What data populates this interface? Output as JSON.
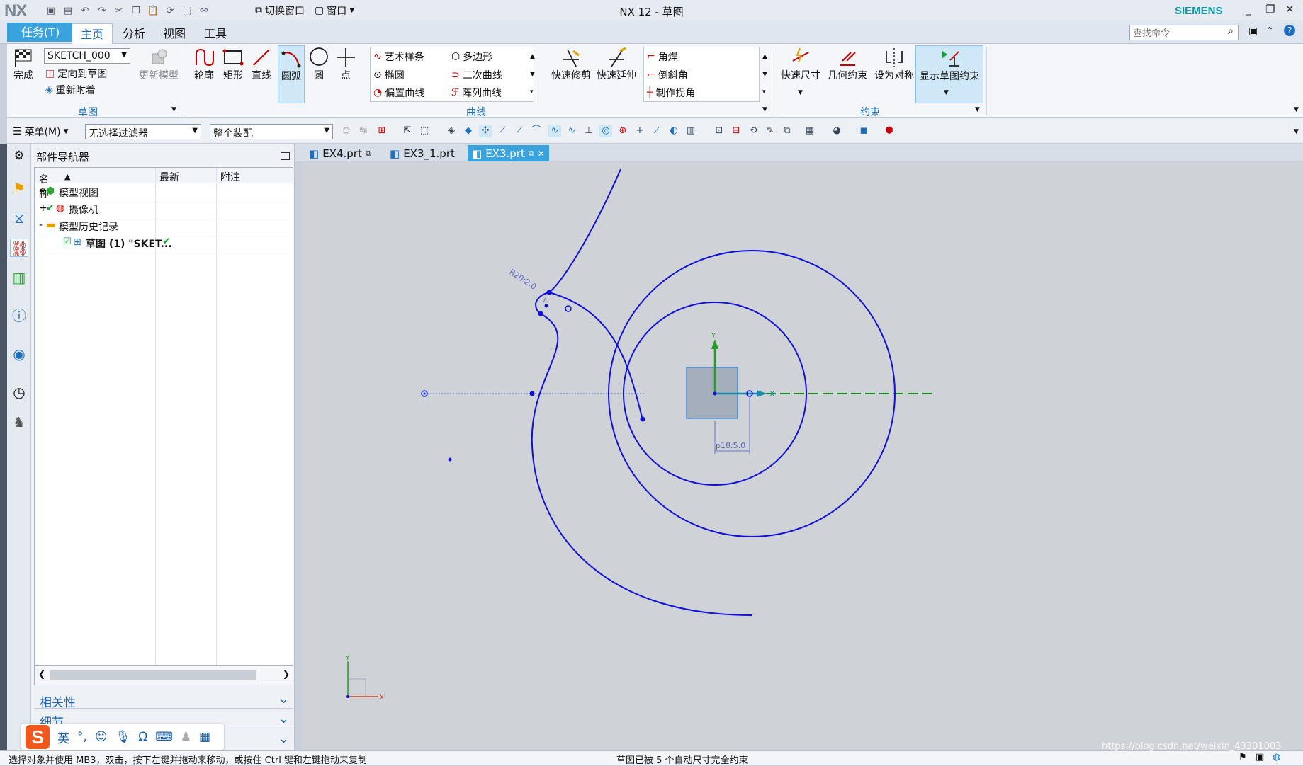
{
  "window": {
    "logo": "NX",
    "title": "NX 12 - 草图",
    "brand": "SIEMENS",
    "switch_window": "切换窗口",
    "window_menu": "窗口"
  },
  "tabs": [
    "任务(T)",
    "主页",
    "分析",
    "视图",
    "工具"
  ],
  "search": {
    "placeholder": "查找命令"
  },
  "ribbon": {
    "sketch_group": {
      "finish": "完成",
      "sketch_name": "SKETCH_000",
      "orient": "定向到草图",
      "reattach": "重新附着",
      "update_model": "更新模型",
      "label": "草图"
    },
    "curve_group": {
      "profile": "轮廓",
      "rectangle": "矩形",
      "line": "直线",
      "arc": "圆弧",
      "circle": "圆",
      "point": "点",
      "studio_spline": "艺术样条",
      "polygon": "多边形",
      "ellipse": "椭圆",
      "conic": "二次曲线",
      "offset_curve": "偏置曲线",
      "pattern_curve": "阵列曲线",
      "fillet": "角焊",
      "chamfer": "倒斜角",
      "make_corner": "制作拐角",
      "quick_trim": "快速修剪",
      "quick_extend": "快速延伸",
      "label": "曲线"
    },
    "constraint_group": {
      "rapid_dimension": "快速尺寸",
      "geometric_constraint": "几何约束",
      "make_symmetric": "设为对称",
      "show_constraints": "显示草图约束",
      "label": "约束"
    }
  },
  "toolbar2": {
    "menu": "菜单(M)",
    "filter": "无选择过滤器",
    "assembly": "整个装配"
  },
  "navigator": {
    "title": "部件导航器",
    "columns": [
      "名称",
      "最新",
      "附注"
    ],
    "rows": [
      {
        "toggle": "+",
        "name": "模型视图"
      },
      {
        "toggle": "+",
        "name": "摄像机"
      },
      {
        "toggle": "-",
        "name": "模型历史记录"
      },
      {
        "toggle": "",
        "name": "草图 (1) \"SKET..."
      }
    ],
    "panels": [
      "相关性",
      "细节"
    ]
  },
  "doc_tabs": [
    "EX4.prt",
    "EX3_1.prt",
    "EX3.prt"
  ],
  "sketch": {
    "radius_label": "R20:2.0",
    "dim_label": "p18:5.0",
    "axis_x": "X",
    "axis_y": "Y"
  },
  "status": {
    "left": "选择对象并使用 MB3，双击，按下左键并拖动来移动，或按住 Ctrl 键和左键拖动来复制",
    "center": "草图已被 5 个自动尺寸完全约束",
    "watermark": "https://blog.csdn.net/weixin_43301003"
  },
  "ime": {
    "logo": "S",
    "lang": "英"
  },
  "colors": {
    "accent": "#3aa3dd",
    "curve": "#1010d8",
    "brand": "#0b9aa5"
  }
}
